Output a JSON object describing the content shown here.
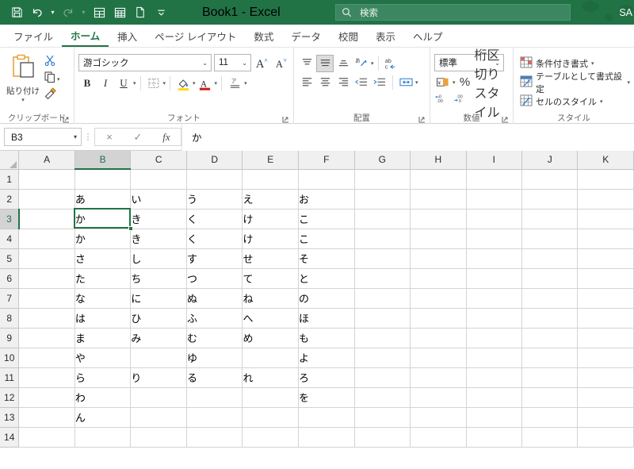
{
  "titlebar": {
    "document_title": "Book1  -  Excel",
    "account_initials": "SA",
    "quick_access": [
      {
        "name": "save",
        "label": "保存"
      },
      {
        "name": "undo",
        "label": "元に戻す"
      },
      {
        "name": "redo",
        "label": "やり直し"
      },
      {
        "name": "table-1",
        "label": "テーブル"
      },
      {
        "name": "table-2",
        "label": "表"
      },
      {
        "name": "new-file",
        "label": "新規"
      },
      {
        "name": "customize",
        "label": "クイック アクセス ツール バーのユーザー設定"
      }
    ]
  },
  "search": {
    "placeholder": "検索",
    "icon": "search-icon"
  },
  "tabs": [
    {
      "label": "ファイル",
      "active": false
    },
    {
      "label": "ホーム",
      "active": true
    },
    {
      "label": "挿入",
      "active": false
    },
    {
      "label": "ページ レイアウト",
      "active": false
    },
    {
      "label": "数式",
      "active": false
    },
    {
      "label": "データ",
      "active": false
    },
    {
      "label": "校閲",
      "active": false
    },
    {
      "label": "表示",
      "active": false
    },
    {
      "label": "ヘルプ",
      "active": false
    }
  ],
  "ribbon": {
    "clipboard": {
      "group_label": "クリップボード",
      "paste_label": "貼り付け",
      "cut_label": "切り取り",
      "copy_label": "コピー",
      "format_painter_label": "書式のコピー/貼り付け"
    },
    "font": {
      "group_label": "フォント",
      "font_name": "游ゴシック",
      "font_size": "11",
      "grow_label": "フォント サイズの拡大",
      "shrink_label": "フォント サイズの縮小",
      "bold_label": "B",
      "italic_label": "I",
      "underline_label": "U",
      "borders_label": "罫線",
      "fill_color_label": "塗りつぶしの色",
      "fill_color": "#ffd800",
      "font_color_label": "フォントの色",
      "font_color": "#d01b1b",
      "phonetic_label": "ふりがなの表示/非表示"
    },
    "alignment": {
      "group_label": "配置",
      "align_top_label": "上揃え",
      "align_middle_label": "中央揃え (上下)",
      "align_bottom_label": "下揃え",
      "orientation_label": "方向",
      "wrap_text_label": "折り返して全体を表示する",
      "align_left_label": "左揃え",
      "align_center_label": "中央揃え",
      "align_right_label": "右揃え",
      "decrease_indent_label": "インデントを減らす",
      "increase_indent_label": "インデントを増やす",
      "merge_label": "セルを結合して中央揃え"
    },
    "number": {
      "group_label": "数値",
      "format": "標準",
      "currency_label": "通貨表示形式",
      "percent_label": "%",
      "comma_label": "桁区切りスタイル",
      "decrease_decimal_label": "小数点以下の表示桁数を減らす",
      "increase_decimal_label": "小数点以下の表示桁数を増やす"
    },
    "styles": {
      "group_label": "スタイル",
      "items": [
        {
          "label": "条件付き書式",
          "icon": "conditional-format-icon"
        },
        {
          "label": "テーブルとして書式設定",
          "icon": "format-as-table-icon"
        },
        {
          "label": "セルのスタイル",
          "icon": "cell-styles-icon"
        }
      ]
    }
  },
  "formula_bar": {
    "name_box": "B3",
    "cancel_label": "×",
    "enter_label": "✓",
    "function_label": "fx",
    "content": "か"
  },
  "grid": {
    "selected_cell": "B3",
    "selected_column": "B",
    "selected_row": "3",
    "columns": [
      "A",
      "B",
      "C",
      "D",
      "E",
      "F",
      "G",
      "H",
      "I",
      "J",
      "K"
    ],
    "rows": [
      "1",
      "2",
      "3",
      "4",
      "5",
      "6",
      "7",
      "8",
      "9",
      "10",
      "11",
      "12",
      "13",
      "14"
    ],
    "cells": [
      [
        "",
        "",
        "",
        "",
        "",
        "",
        "",
        "",
        "",
        "",
        ""
      ],
      [
        "",
        "あ",
        "い",
        "う",
        "え",
        "お",
        "",
        "",
        "",
        "",
        ""
      ],
      [
        "",
        "か",
        "き",
        "く",
        "け",
        "こ",
        "",
        "",
        "",
        "",
        ""
      ],
      [
        "",
        "か",
        "き",
        "く",
        "け",
        "こ",
        "",
        "",
        "",
        "",
        ""
      ],
      [
        "",
        "さ",
        "し",
        "す",
        "せ",
        "そ",
        "",
        "",
        "",
        "",
        ""
      ],
      [
        "",
        "た",
        "ち",
        "つ",
        "て",
        "と",
        "",
        "",
        "",
        "",
        ""
      ],
      [
        "",
        "な",
        "に",
        "ぬ",
        "ね",
        "の",
        "",
        "",
        "",
        "",
        ""
      ],
      [
        "",
        "は",
        "ひ",
        "ふ",
        "へ",
        "ほ",
        "",
        "",
        "",
        "",
        ""
      ],
      [
        "",
        "ま",
        "み",
        "む",
        "め",
        "も",
        "",
        "",
        "",
        "",
        ""
      ],
      [
        "",
        "や",
        "",
        "ゆ",
        "",
        "よ",
        "",
        "",
        "",
        "",
        ""
      ],
      [
        "",
        "ら",
        "り",
        "る",
        "れ",
        "ろ",
        "",
        "",
        "",
        "",
        ""
      ],
      [
        "",
        "わ",
        "",
        "",
        "",
        "を",
        "",
        "",
        "",
        "",
        ""
      ],
      [
        "",
        "ん",
        "",
        "",
        "",
        "",
        "",
        "",
        "",
        "",
        ""
      ],
      [
        "",
        "",
        "",
        "",
        "",
        "",
        "",
        "",
        "",
        "",
        ""
      ]
    ]
  },
  "colors": {
    "brand_green": "#217346",
    "ribbon_bg": "#ffffff",
    "header_gray": "#f0f0f0",
    "gridline": "#d4d4d4"
  }
}
